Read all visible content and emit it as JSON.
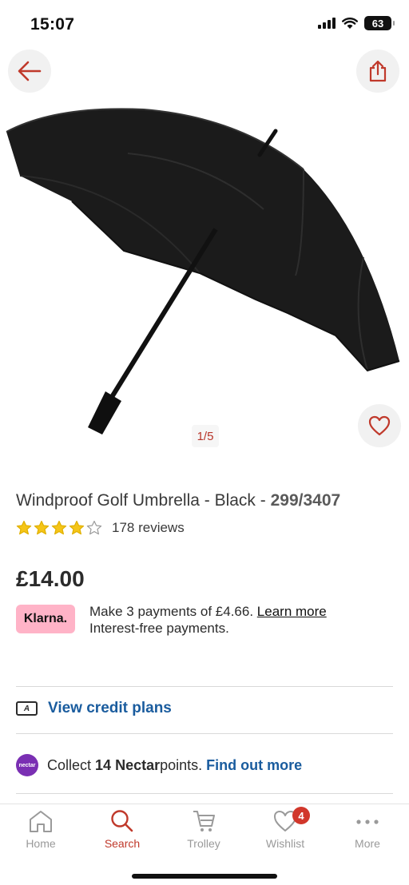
{
  "status": {
    "time": "15:07",
    "battery": "63"
  },
  "hero": {
    "image_counter": "1/5"
  },
  "product": {
    "title": "Windproof Golf Umbrella - Black - ",
    "code": "299/3407",
    "rating": 4,
    "reviews": "178 reviews",
    "price": "£14.00"
  },
  "klarna": {
    "badge": "Klarna.",
    "line1": "Make 3 payments of £4.66. ",
    "learn_more": "Learn more",
    "line2": "Interest-free payments."
  },
  "credit": {
    "label": "View credit plans"
  },
  "nectar": {
    "icon_text": "nectar",
    "prefix": "Collect ",
    "points": "14 Nectar",
    "suffix": " points.",
    "link": "Find out more"
  },
  "tabbar": {
    "items": [
      {
        "label": "Home",
        "icon": "home-icon"
      },
      {
        "label": "Search",
        "icon": "search-icon"
      },
      {
        "label": "Trolley",
        "icon": "trolley-icon"
      },
      {
        "label": "Wishlist",
        "icon": "heart-icon",
        "badge": "4"
      },
      {
        "label": "More",
        "icon": "more-icon"
      }
    ],
    "active": "Search"
  },
  "colors": {
    "accent": "#c0392b",
    "link": "#1a5c9e",
    "klarna": "#ffb3c7",
    "nectar": "#7a2fb3"
  }
}
